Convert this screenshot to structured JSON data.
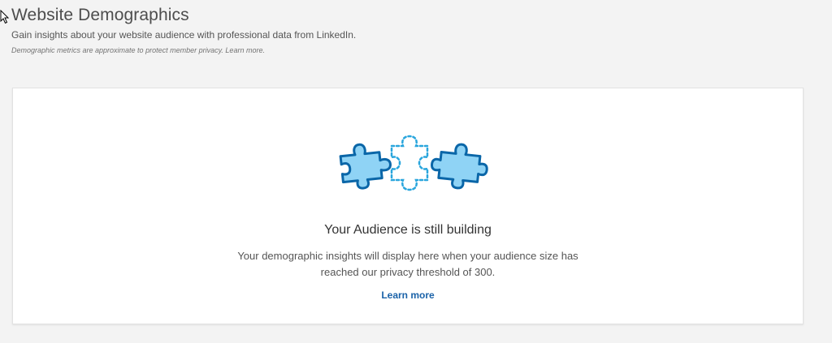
{
  "header": {
    "title": "Website Demographics",
    "subtitle": "Gain insights about your website audience with professional data from LinkedIn.",
    "note": "Demographic metrics are approximate to protect member privacy. Learn more."
  },
  "empty_state": {
    "title": "Your Audience is still building",
    "description": "Your demographic insights will display here when your audience size has reached our privacy threshold of 300.",
    "link_label": "Learn more",
    "illustration_icon": "puzzle-pieces-icon"
  },
  "colors": {
    "background": "#f3f3f3",
    "card": "#ffffff",
    "link": "#1a62a8",
    "puzzle_fill": "#8fd3f5",
    "puzzle_stroke": "#0a66a8",
    "puzzle_dotted": "#2aa6dd"
  }
}
